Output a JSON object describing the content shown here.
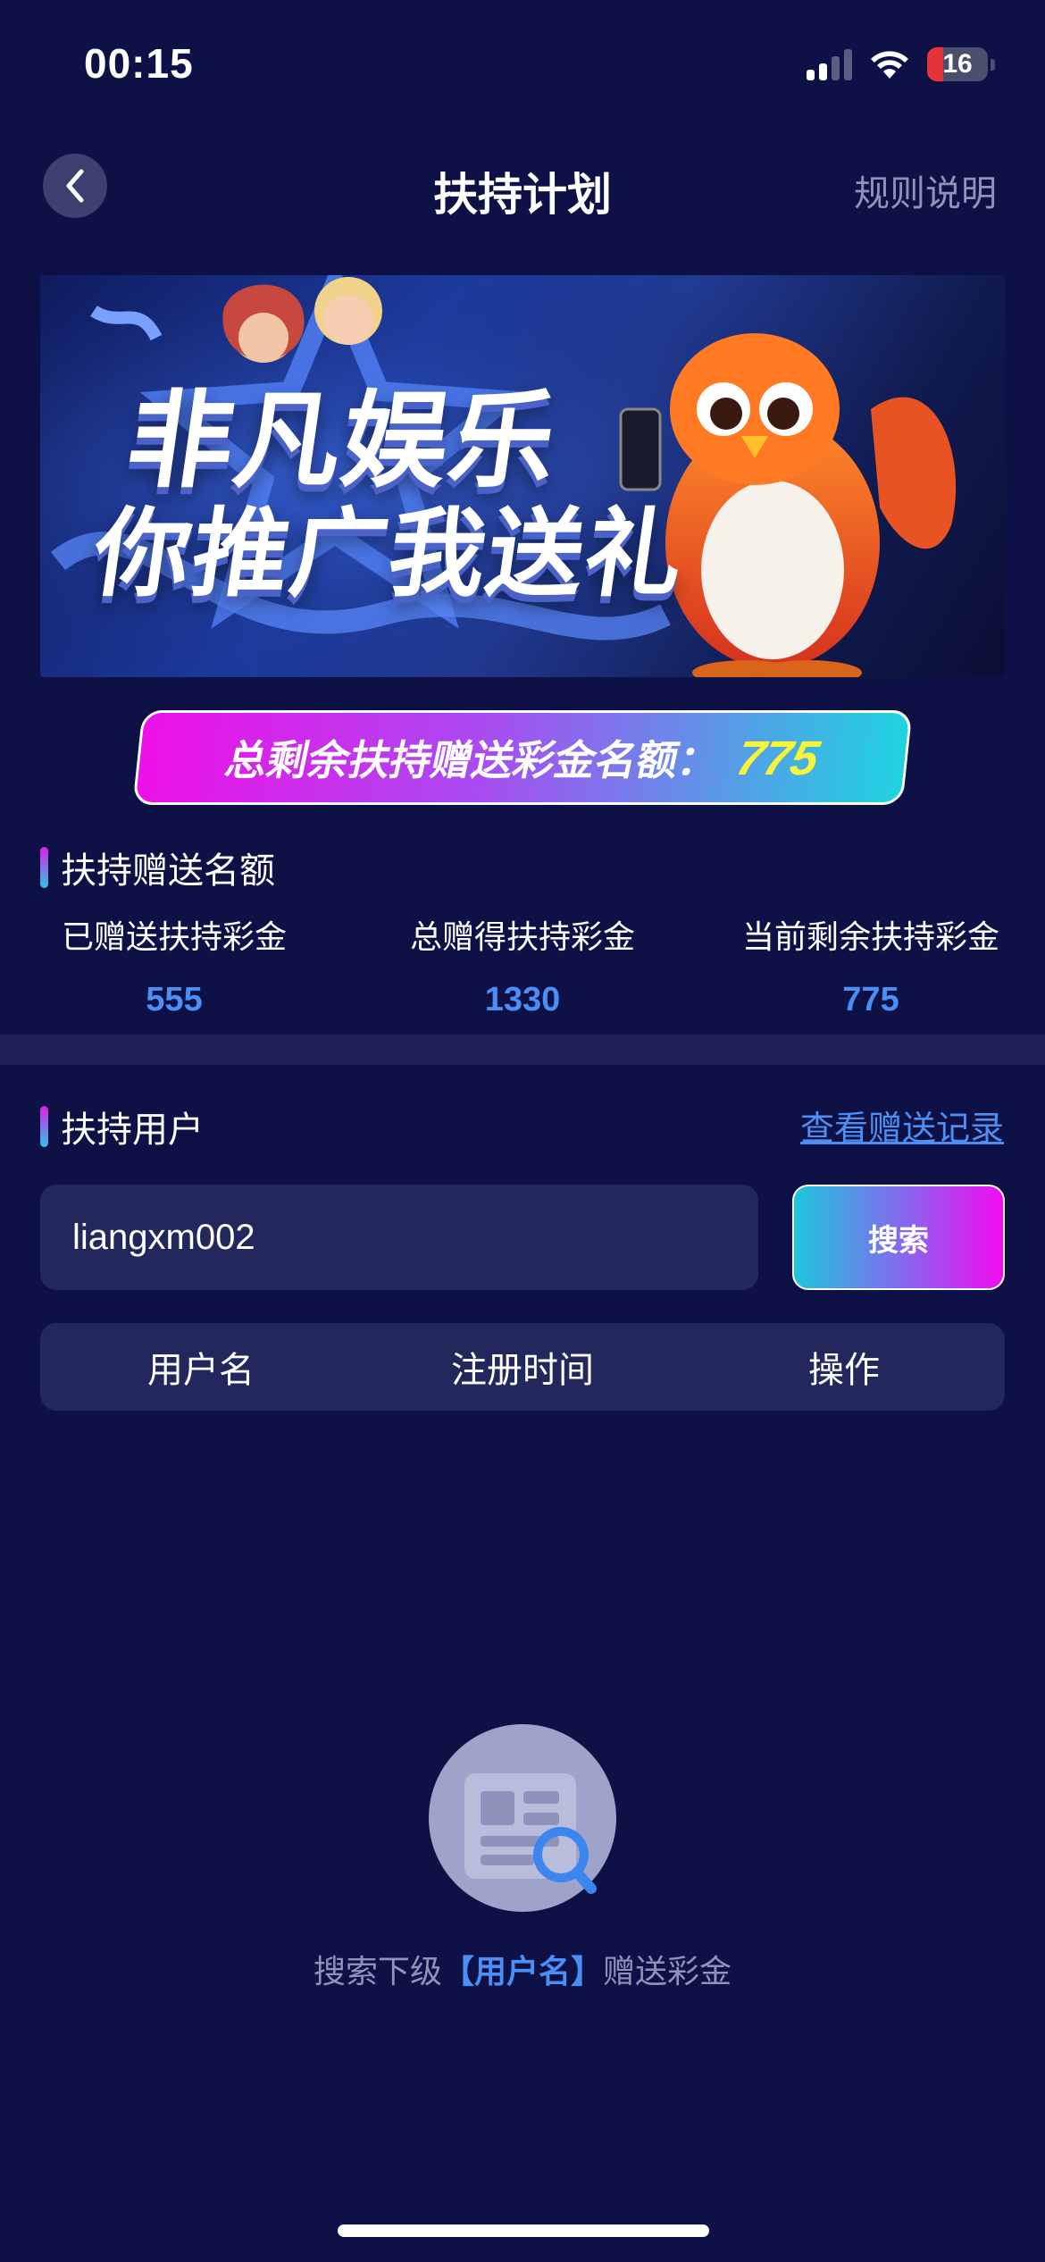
{
  "status_bar": {
    "time": "00:15",
    "battery": "16"
  },
  "nav": {
    "title": "扶持计划",
    "rules_link": "规则说明"
  },
  "banner": {
    "line1": "非凡娱乐",
    "line2": "你推广我送礼"
  },
  "quota": {
    "label": "总剩余扶持赠送彩金名额：",
    "value": "775"
  },
  "support_quota": {
    "title": "扶持赠送名额",
    "stats": [
      {
        "label": "已赠送扶持彩金",
        "value": "555"
      },
      {
        "label": "总赠得扶持彩金",
        "value": "1330"
      },
      {
        "label": "当前剩余扶持彩金",
        "value": "775"
      }
    ]
  },
  "support_users": {
    "title": "扶持用户",
    "records_link": "查看赠送记录",
    "search": {
      "value": "liangxm002",
      "button": "搜索"
    },
    "table_headers": [
      "用户名",
      "注册时间",
      "操作"
    ],
    "empty": {
      "prefix": "搜索下级",
      "highlight": "【用户名】",
      "suffix": "赠送彩金"
    }
  },
  "colors": {
    "background": "#0d1145",
    "accent_blue": "#4b8ef5",
    "pill_yellow": "#f9f33a",
    "gradient_magenta": "#ee10e8",
    "gradient_cyan": "#1fd3e0"
  },
  "icons": [
    "chevron-left-icon",
    "signal-icon",
    "wifi-icon",
    "battery-icon",
    "search-document-icon"
  ]
}
